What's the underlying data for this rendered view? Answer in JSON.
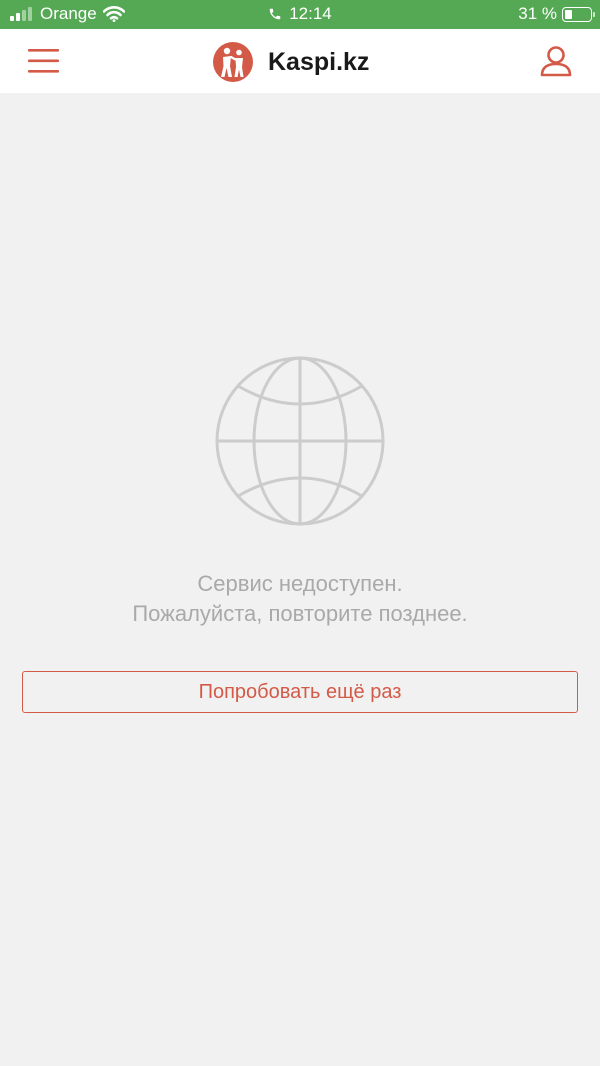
{
  "status_bar": {
    "carrier": "Orange",
    "time": "12:14",
    "battery_text": "31 %",
    "battery_level": 0.31,
    "signal_icon": "signal-bars-icon",
    "wifi_icon": "wifi-icon",
    "call_icon": "phone-call-icon",
    "color": "#55a955"
  },
  "header": {
    "brand": "Kaspi.kz",
    "menu_icon": "hamburger-menu-icon",
    "profile_icon": "user-profile-icon",
    "accent": "#d45a48"
  },
  "main": {
    "illustration_icon": "globe-icon",
    "message_line1": "Сервис недоступен.",
    "message_line2": "Пожалуйста, повторите позднее.",
    "retry_label": "Попробовать ещё раз"
  }
}
